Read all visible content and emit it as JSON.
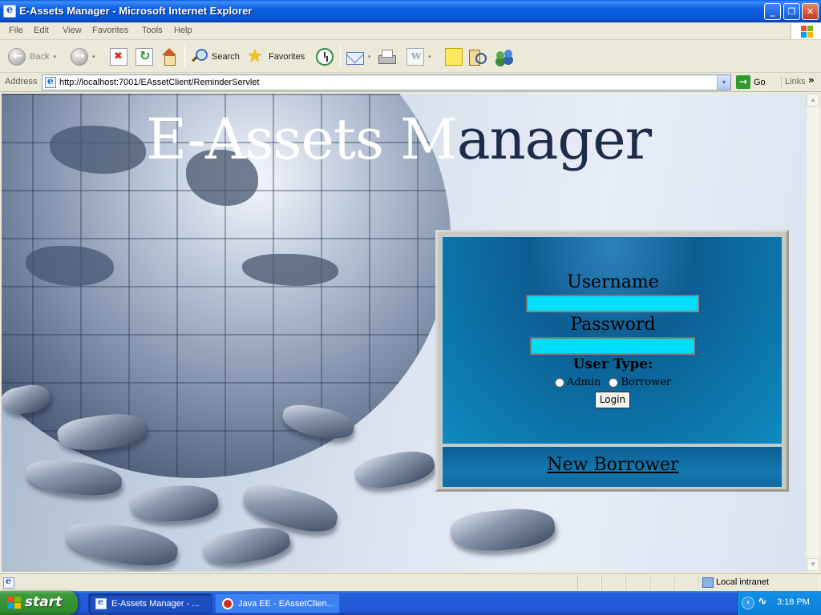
{
  "window": {
    "title": "E-Assets Manager - Microsoft Internet Explorer",
    "controls": {
      "minimize": "_",
      "maximize": "❐",
      "close": "✕"
    }
  },
  "menu": {
    "items": [
      "File",
      "Edit",
      "View",
      "Favorites",
      "Tools",
      "Help"
    ]
  },
  "toolbar": {
    "back_label": "Back",
    "search_label": "Search",
    "favorites_label": "Favorites",
    "dropdown_glyph": "▾"
  },
  "address": {
    "label": "Address",
    "url": "http://localhost:7001/EAssetClient/ReminderServlet",
    "go_label": "Go",
    "links_label": "Links",
    "links_chevron": "»"
  },
  "page": {
    "heading_light": "E-Assets M",
    "heading_dark": "anager",
    "login": {
      "username_label": "Username",
      "username_value": "",
      "password_label": "Password",
      "password_value": "",
      "user_type_label": "User Type:",
      "options": [
        "Admin",
        "Borrower"
      ],
      "login_button": "Login",
      "new_borrower_link": "New Borrower"
    }
  },
  "statusbar": {
    "status_text": "",
    "zone": "Local intranet"
  },
  "taskbar": {
    "start_label": "start",
    "tasks": [
      {
        "label": "E-Assets Manager - ...",
        "icon": "ie-icon",
        "active": true
      },
      {
        "label": "Java EE - EAssetClien...",
        "icon": "oracle-icon",
        "active": false
      }
    ],
    "clock": "3:18 PM"
  },
  "colors": {
    "titlebar": "#0a5fe0",
    "input_fill": "#00ddff",
    "panel_blue": "#0b74a8",
    "heading_dark": "#1d2c4a"
  }
}
